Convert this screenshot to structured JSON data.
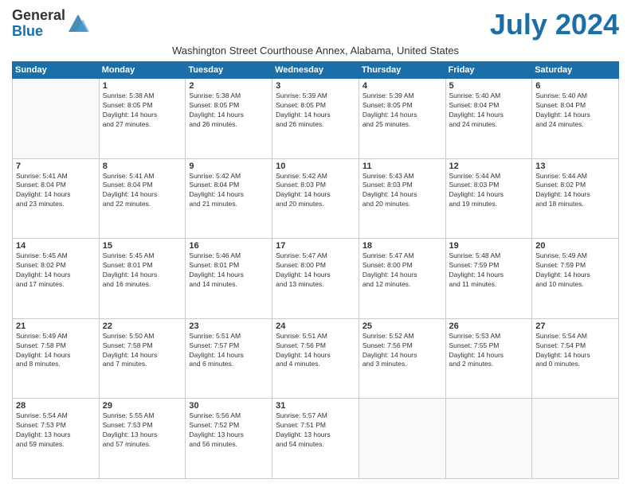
{
  "header": {
    "logo_general": "General",
    "logo_blue": "Blue",
    "title": "July 2024",
    "subtitle": "Washington Street Courthouse Annex, Alabama, United States"
  },
  "weekdays": [
    "Sunday",
    "Monday",
    "Tuesday",
    "Wednesday",
    "Thursday",
    "Friday",
    "Saturday"
  ],
  "weeks": [
    [
      {
        "day": "",
        "info": ""
      },
      {
        "day": "1",
        "info": "Sunrise: 5:38 AM\nSunset: 8:05 PM\nDaylight: 14 hours\nand 27 minutes."
      },
      {
        "day": "2",
        "info": "Sunrise: 5:38 AM\nSunset: 8:05 PM\nDaylight: 14 hours\nand 26 minutes."
      },
      {
        "day": "3",
        "info": "Sunrise: 5:39 AM\nSunset: 8:05 PM\nDaylight: 14 hours\nand 26 minutes."
      },
      {
        "day": "4",
        "info": "Sunrise: 5:39 AM\nSunset: 8:05 PM\nDaylight: 14 hours\nand 25 minutes."
      },
      {
        "day": "5",
        "info": "Sunrise: 5:40 AM\nSunset: 8:04 PM\nDaylight: 14 hours\nand 24 minutes."
      },
      {
        "day": "6",
        "info": "Sunrise: 5:40 AM\nSunset: 8:04 PM\nDaylight: 14 hours\nand 24 minutes."
      }
    ],
    [
      {
        "day": "7",
        "info": "Sunrise: 5:41 AM\nSunset: 8:04 PM\nDaylight: 14 hours\nand 23 minutes."
      },
      {
        "day": "8",
        "info": "Sunrise: 5:41 AM\nSunset: 8:04 PM\nDaylight: 14 hours\nand 22 minutes."
      },
      {
        "day": "9",
        "info": "Sunrise: 5:42 AM\nSunset: 8:04 PM\nDaylight: 14 hours\nand 21 minutes."
      },
      {
        "day": "10",
        "info": "Sunrise: 5:42 AM\nSunset: 8:03 PM\nDaylight: 14 hours\nand 20 minutes."
      },
      {
        "day": "11",
        "info": "Sunrise: 5:43 AM\nSunset: 8:03 PM\nDaylight: 14 hours\nand 20 minutes."
      },
      {
        "day": "12",
        "info": "Sunrise: 5:44 AM\nSunset: 8:03 PM\nDaylight: 14 hours\nand 19 minutes."
      },
      {
        "day": "13",
        "info": "Sunrise: 5:44 AM\nSunset: 8:02 PM\nDaylight: 14 hours\nand 18 minutes."
      }
    ],
    [
      {
        "day": "14",
        "info": "Sunrise: 5:45 AM\nSunset: 8:02 PM\nDaylight: 14 hours\nand 17 minutes."
      },
      {
        "day": "15",
        "info": "Sunrise: 5:45 AM\nSunset: 8:01 PM\nDaylight: 14 hours\nand 16 minutes."
      },
      {
        "day": "16",
        "info": "Sunrise: 5:46 AM\nSunset: 8:01 PM\nDaylight: 14 hours\nand 14 minutes."
      },
      {
        "day": "17",
        "info": "Sunrise: 5:47 AM\nSunset: 8:00 PM\nDaylight: 14 hours\nand 13 minutes."
      },
      {
        "day": "18",
        "info": "Sunrise: 5:47 AM\nSunset: 8:00 PM\nDaylight: 14 hours\nand 12 minutes."
      },
      {
        "day": "19",
        "info": "Sunrise: 5:48 AM\nSunset: 7:59 PM\nDaylight: 14 hours\nand 11 minutes."
      },
      {
        "day": "20",
        "info": "Sunrise: 5:49 AM\nSunset: 7:59 PM\nDaylight: 14 hours\nand 10 minutes."
      }
    ],
    [
      {
        "day": "21",
        "info": "Sunrise: 5:49 AM\nSunset: 7:58 PM\nDaylight: 14 hours\nand 8 minutes."
      },
      {
        "day": "22",
        "info": "Sunrise: 5:50 AM\nSunset: 7:58 PM\nDaylight: 14 hours\nand 7 minutes."
      },
      {
        "day": "23",
        "info": "Sunrise: 5:51 AM\nSunset: 7:57 PM\nDaylight: 14 hours\nand 6 minutes."
      },
      {
        "day": "24",
        "info": "Sunrise: 5:51 AM\nSunset: 7:56 PM\nDaylight: 14 hours\nand 4 minutes."
      },
      {
        "day": "25",
        "info": "Sunrise: 5:52 AM\nSunset: 7:56 PM\nDaylight: 14 hours\nand 3 minutes."
      },
      {
        "day": "26",
        "info": "Sunrise: 5:53 AM\nSunset: 7:55 PM\nDaylight: 14 hours\nand 2 minutes."
      },
      {
        "day": "27",
        "info": "Sunrise: 5:54 AM\nSunset: 7:54 PM\nDaylight: 14 hours\nand 0 minutes."
      }
    ],
    [
      {
        "day": "28",
        "info": "Sunrise: 5:54 AM\nSunset: 7:53 PM\nDaylight: 13 hours\nand 59 minutes."
      },
      {
        "day": "29",
        "info": "Sunrise: 5:55 AM\nSunset: 7:53 PM\nDaylight: 13 hours\nand 57 minutes."
      },
      {
        "day": "30",
        "info": "Sunrise: 5:56 AM\nSunset: 7:52 PM\nDaylight: 13 hours\nand 56 minutes."
      },
      {
        "day": "31",
        "info": "Sunrise: 5:57 AM\nSunset: 7:51 PM\nDaylight: 13 hours\nand 54 minutes."
      },
      {
        "day": "",
        "info": ""
      },
      {
        "day": "",
        "info": ""
      },
      {
        "day": "",
        "info": ""
      }
    ]
  ]
}
